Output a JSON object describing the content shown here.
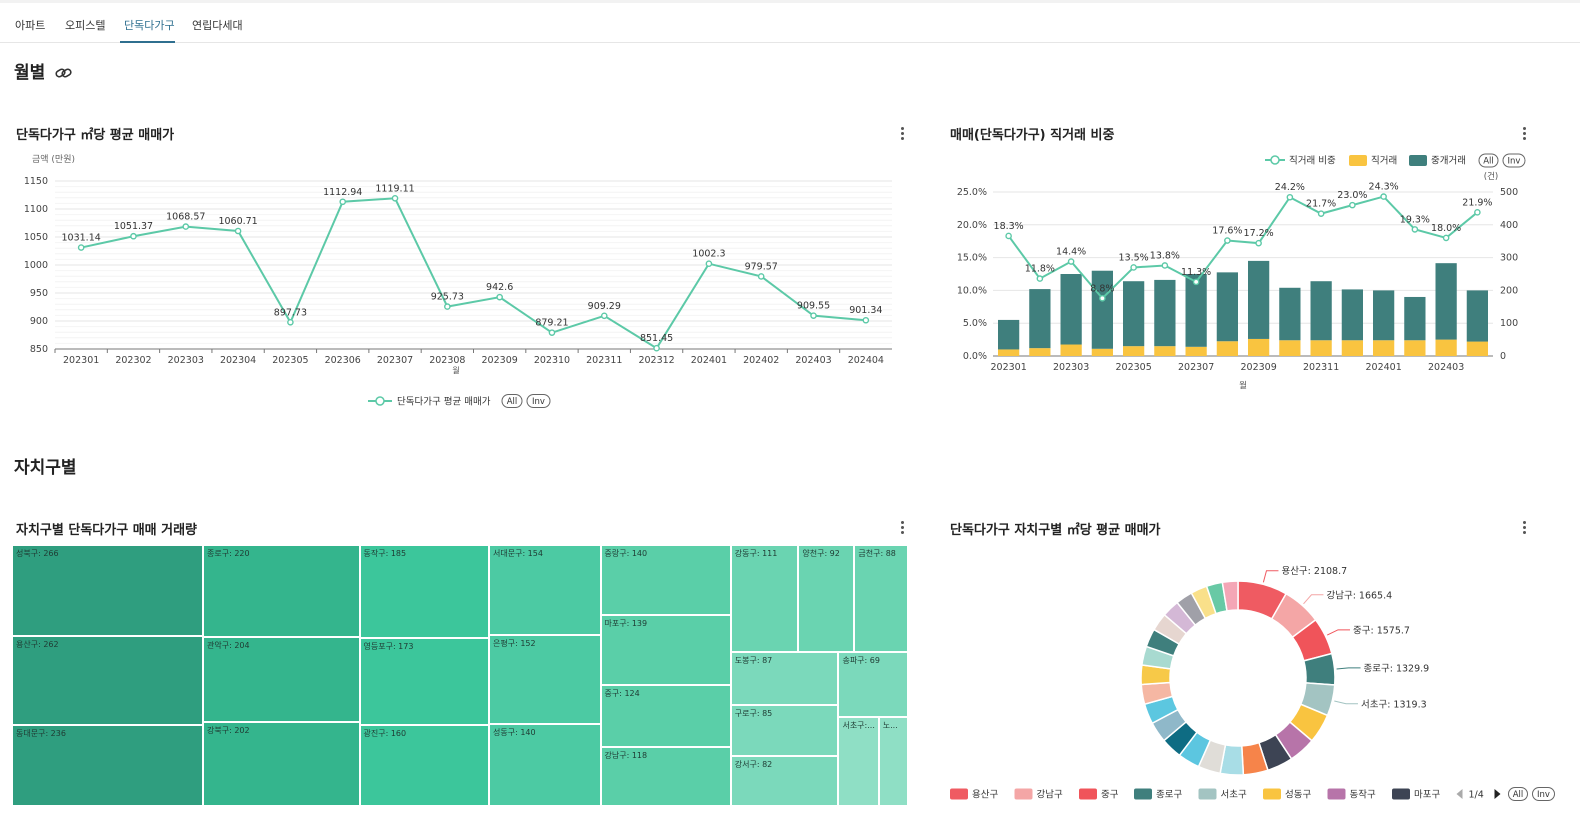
{
  "tabs": [
    {
      "label": "아파트",
      "active": false
    },
    {
      "label": "오피스텔",
      "active": false
    },
    {
      "label": "단독다가구",
      "active": true
    },
    {
      "label": "연립다세대",
      "active": false
    }
  ],
  "sections": {
    "monthly": "월별",
    "district": "자치구별"
  },
  "charts": {
    "line": {
      "title": "단독다가구 ㎡당 평균 매매가",
      "ylabel": "금액 (만원)",
      "xlabel": "월",
      "legend_label": "단독다가구 평균 매매가",
      "all_label": "All",
      "inv_label": "Inv"
    },
    "combo": {
      "title": "매매(단독다가구) 직거래 비중",
      "legend_ratio": "직거래 비중",
      "legend_direct": "직거래",
      "legend_broker": "중개거래",
      "all_label": "All",
      "inv_label": "Inv",
      "y2_unit": "(건)",
      "xlabel": "월"
    },
    "treemap": {
      "title": "자치구별 단독다가구 매매 거래량"
    },
    "donut": {
      "title": "단독다가구 자치구별 ㎡당 평균 매매가",
      "page_label": "1/4",
      "all_label": "All",
      "inv_label": "Inv"
    }
  },
  "chart_data": [
    {
      "type": "line",
      "title": "단독다가구 ㎡당 평균 매매가",
      "ylabel": "금액 (만원)",
      "xlabel": "월",
      "ylim": [
        850,
        1150
      ],
      "yticks": [
        850,
        900,
        950,
        1000,
        1050,
        1100,
        1150
      ],
      "categories": [
        "202301",
        "202302",
        "202303",
        "202304",
        "202305",
        "202306",
        "202307",
        "202308",
        "202309",
        "202310",
        "202311",
        "202312",
        "202401",
        "202402",
        "202403",
        "202404"
      ],
      "series": [
        {
          "name": "단독다가구 평균 매매가",
          "color": "#5cc9a7",
          "values": [
            1031.14,
            1051.37,
            1068.57,
            1060.71,
            897.73,
            1112.94,
            1119.11,
            925.73,
            942.6,
            879.21,
            909.29,
            851.45,
            1002.3,
            979.57,
            909.55,
            901.34
          ]
        }
      ],
      "grid": true,
      "legend": "bottom-center"
    },
    {
      "type": "bar",
      "title": "매매(단독다가구) 직거래 비중",
      "xlabel": "월",
      "categories": [
        "202301",
        "202302",
        "202303",
        "202304",
        "202305",
        "202306",
        "202307",
        "202308",
        "202309",
        "202310",
        "202311",
        "202312",
        "202401",
        "202402",
        "202403",
        "202404"
      ],
      "xtick_labels": [
        "202301",
        "202303",
        "202305",
        "202307",
        "202309",
        "202311",
        "202401",
        "202403"
      ],
      "y_left_ticks": [
        "0.0%",
        "5.0%",
        "10.0%",
        "15.0%",
        "20.0%",
        "25.0%"
      ],
      "y_left_lim": [
        0,
        25
      ],
      "y_right_ticks": [
        "0",
        "100",
        "200",
        "300",
        "400",
        "500"
      ],
      "y_right_lim": [
        0,
        500
      ],
      "series": [
        {
          "name": "직거래",
          "kind": "bar-stack",
          "color": "#f9c440",
          "values": [
            20,
            24,
            35,
            22,
            30,
            30,
            28,
            45,
            52,
            48,
            48,
            48,
            48,
            48,
            50,
            44
          ]
        },
        {
          "name": "중개거래",
          "kind": "bar-stack",
          "color": "#3f7f7d",
          "values": [
            90,
            180,
            215,
            238,
            198,
            202,
            222,
            210,
            238,
            160,
            180,
            155,
            152,
            132,
            233,
            156
          ]
        },
        {
          "name": "직거래 비중",
          "kind": "line",
          "color": "#5cc9a7",
          "values": [
            18.3,
            11.8,
            14.4,
            8.8,
            13.5,
            13.8,
            11.3,
            17.6,
            17.2,
            24.2,
            21.7,
            23.0,
            24.3,
            19.3,
            18.0,
            21.9
          ],
          "labels": [
            "18.3%",
            "11.8%",
            "14.4%",
            "8.8%",
            "13.5%",
            "13.8%",
            "11.3%",
            "17.6%",
            "17.2%",
            "24.2%",
            "21.7%",
            "23.0%",
            "24.3%",
            "19.3%",
            "18.0%",
            "21.9%"
          ]
        }
      ],
      "legend": "top-right"
    },
    {
      "type": "treemap",
      "title": "자치구별 단독다가구 매매 거래량",
      "items": [
        {
          "name": "성북구: 266",
          "value": 266
        },
        {
          "name": "용산구: 262",
          "value": 262
        },
        {
          "name": "동대문구: 236",
          "value": 236
        },
        {
          "name": "종로구: 220",
          "value": 220
        },
        {
          "name": "관악구: 204",
          "value": 204
        },
        {
          "name": "강북구: 202",
          "value": 202
        },
        {
          "name": "동작구: 185",
          "value": 185
        },
        {
          "name": "영등포구: 173",
          "value": 173
        },
        {
          "name": "광진구: 160",
          "value": 160
        },
        {
          "name": "서대문구: 154",
          "value": 154
        },
        {
          "name": "은평구: 152",
          "value": 152
        },
        {
          "name": "성동구: 140",
          "value": 140
        },
        {
          "name": "중랑구: 140",
          "value": 140
        },
        {
          "name": "마포구: 139",
          "value": 139
        },
        {
          "name": "중구: 124",
          "value": 124
        },
        {
          "name": "강남구: 118",
          "value": 118
        },
        {
          "name": "강동구: 111",
          "value": 111
        },
        {
          "name": "양천구: 92",
          "value": 92
        },
        {
          "name": "금천구: 88",
          "value": 88
        },
        {
          "name": "도봉구: 87",
          "value": 87
        },
        {
          "name": "구로구: 85",
          "value": 85
        },
        {
          "name": "강서구: 82",
          "value": 82
        },
        {
          "name": "송파구: 69",
          "value": 69
        },
        {
          "name": "서초구:...",
          "value": 55
        },
        {
          "name": "노...",
          "value": 40
        }
      ]
    },
    {
      "type": "pie",
      "title": "단독다가구 자치구별 ㎡당 평균 매매가",
      "labeled": [
        {
          "name": "용산구: 2108.7",
          "value": 2108.7,
          "color": "#ef5b62"
        },
        {
          "name": "강남구: 1665.4",
          "value": 1665.4,
          "color": "#f4a6a6"
        },
        {
          "name": "중구: 1575.7",
          "value": 1575.7,
          "color": "#f0545a"
        },
        {
          "name": "종로구: 1329.9",
          "value": 1329.9,
          "color": "#3f7f7d"
        },
        {
          "name": "서초구: 1319.3",
          "value": 1319.3,
          "color": "#a3c4c2"
        }
      ],
      "other_values": [
        1250,
        1150,
        1100,
        1050,
        980,
        950,
        930,
        900,
        880,
        860,
        840,
        820,
        800,
        780,
        760,
        740,
        720,
        700,
        680,
        660
      ],
      "other_colors": [
        "#f9c440",
        "#b774a9",
        "#3d4454",
        "#f6844a",
        "#a8dde6",
        "#e0ddd8",
        "#5cc6e0",
        "#0e6c83",
        "#8fb8c9",
        "#5cc7e0",
        "#f5b7a3",
        "#f7c948",
        "#a8dad0",
        "#3f7f7d",
        "#e6d6d0",
        "#d4b8d6",
        "#a0a0a8",
        "#f9e08a",
        "#68c9a5",
        "#f4a6b6"
      ],
      "legend": [
        {
          "name": "용산구",
          "color": "#ef5b62"
        },
        {
          "name": "강남구",
          "color": "#f4a6a6"
        },
        {
          "name": "중구",
          "color": "#f0545a"
        },
        {
          "name": "종로구",
          "color": "#3f7f7d"
        },
        {
          "name": "서초구",
          "color": "#a3c4c2"
        },
        {
          "name": "성동구",
          "color": "#f9c440"
        },
        {
          "name": "동작구",
          "color": "#b774a9"
        },
        {
          "name": "마포구",
          "color": "#3d4454"
        }
      ]
    }
  ]
}
